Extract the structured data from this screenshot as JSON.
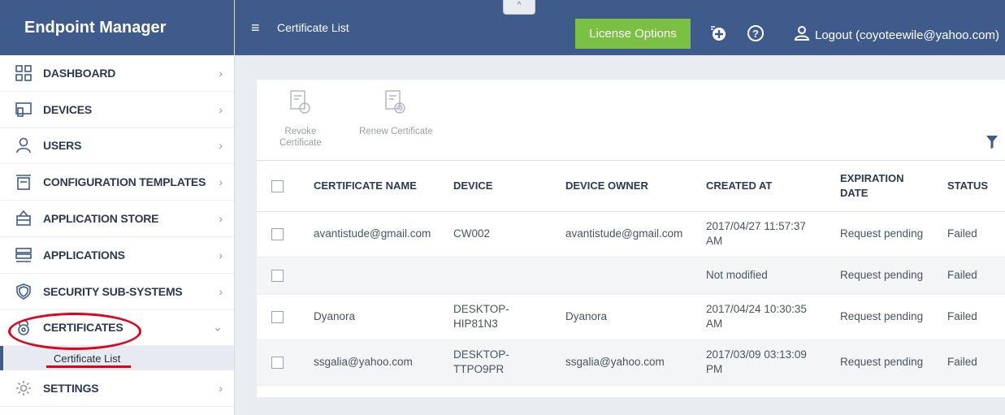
{
  "app": {
    "title": "Endpoint Manager"
  },
  "header": {
    "page_title": "Certificate List",
    "license_button": "License Options",
    "logout_label": "Logout (coyoteewile@yahoo.com)",
    "collapse_glyph": "^"
  },
  "sidebar": {
    "items": [
      {
        "label": "DASHBOARD",
        "icon": "dashboard-icon"
      },
      {
        "label": "DEVICES",
        "icon": "devices-icon"
      },
      {
        "label": "USERS",
        "icon": "user-icon"
      },
      {
        "label": "CONFIGURATION TEMPLATES",
        "icon": "templates-icon"
      },
      {
        "label": "APPLICATION STORE",
        "icon": "store-icon"
      },
      {
        "label": "APPLICATIONS",
        "icon": "applications-icon"
      },
      {
        "label": "SECURITY SUB-SYSTEMS",
        "icon": "shield-icon"
      },
      {
        "label": "CERTIFICATES",
        "icon": "lock-icon",
        "expanded": true
      },
      {
        "label": "SETTINGS",
        "icon": "gear-icon"
      }
    ],
    "sub_item": "Certificate List"
  },
  "toolbar": {
    "revoke_label_1": "Revoke",
    "revoke_label_2": "Certificate",
    "renew_label": "Renew Certificate"
  },
  "table": {
    "columns": [
      "CERTIFICATE NAME",
      "DEVICE",
      "DEVICE OWNER",
      "CREATED AT",
      "EXPIRATION",
      "DATE",
      "STATUS"
    ],
    "rows": [
      {
        "name": "avantistude@gmail.com",
        "device_1": "CW002",
        "device_2": "",
        "owner": "avantistude@gmail.com",
        "created_1": "2017/04/27 11:57:37",
        "created_2": "AM",
        "expiration": "Request pending",
        "status": "Failed"
      },
      {
        "name": "",
        "device_1": "",
        "device_2": "",
        "owner": "",
        "created_1": "Not modified",
        "created_2": "",
        "expiration": "Request pending",
        "status": "Failed"
      },
      {
        "name": "Dyanora",
        "device_1": "DESKTOP-",
        "device_2": "HIP81N3",
        "owner": "Dyanora",
        "created_1": "2017/04/24 10:30:35",
        "created_2": "AM",
        "expiration": "Request pending",
        "status": "Failed"
      },
      {
        "name": "ssgalia@yahoo.com",
        "device_1": "DESKTOP-",
        "device_2": "TTPO9PR",
        "owner": "ssgalia@yahoo.com",
        "created_1": "2017/03/09 03:13:09",
        "created_2": "PM",
        "expiration": "Request pending",
        "status": "Failed"
      }
    ]
  },
  "colors": {
    "header_bg": "#3f5b8c",
    "license_green": "#7ac143",
    "annotation_red": "#e0001a"
  }
}
